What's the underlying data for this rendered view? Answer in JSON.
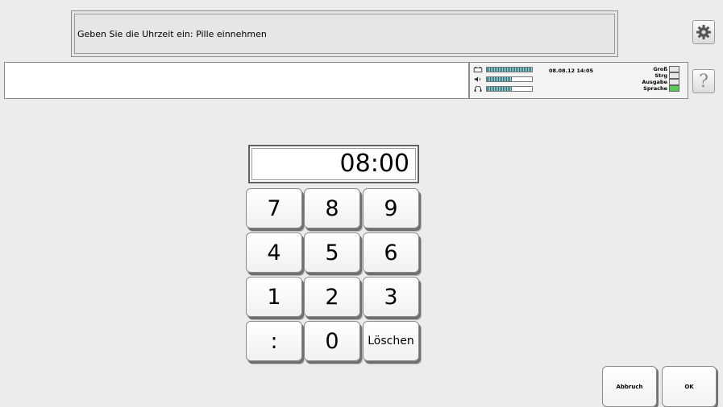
{
  "prompt": {
    "text": "Geben Sie die Uhrzeit ein: Pille einnehmen"
  },
  "input_line": {
    "value": ""
  },
  "status": {
    "datetime": "08.08.12 14:05",
    "meters": [
      {
        "icon": "battery-icon",
        "level": 1.0
      },
      {
        "icon": "speaker-icon",
        "level": 0.55
      },
      {
        "icon": "headphones-icon",
        "level": 0.55
      }
    ],
    "flags": [
      {
        "label": "Groß",
        "active": false
      },
      {
        "label": "Strg",
        "active": false
      },
      {
        "label": "Ausgabe",
        "active": false
      },
      {
        "label": "Sprache",
        "active": true
      }
    ],
    "active_color": "#55cc55"
  },
  "icons": {
    "settings": "gear-icon",
    "help": "question-mark-icon"
  },
  "help_label": "?",
  "time_display": "08:00",
  "keypad": {
    "k7": "7",
    "k8": "8",
    "k9": "9",
    "k4": "4",
    "k5": "5",
    "k6": "6",
    "k1": "1",
    "k2": "2",
    "k3": "3",
    "colon": ":",
    "k0": "0",
    "clear": "Löschen"
  },
  "buttons": {
    "cancel": "Abbruch",
    "ok": "OK"
  }
}
